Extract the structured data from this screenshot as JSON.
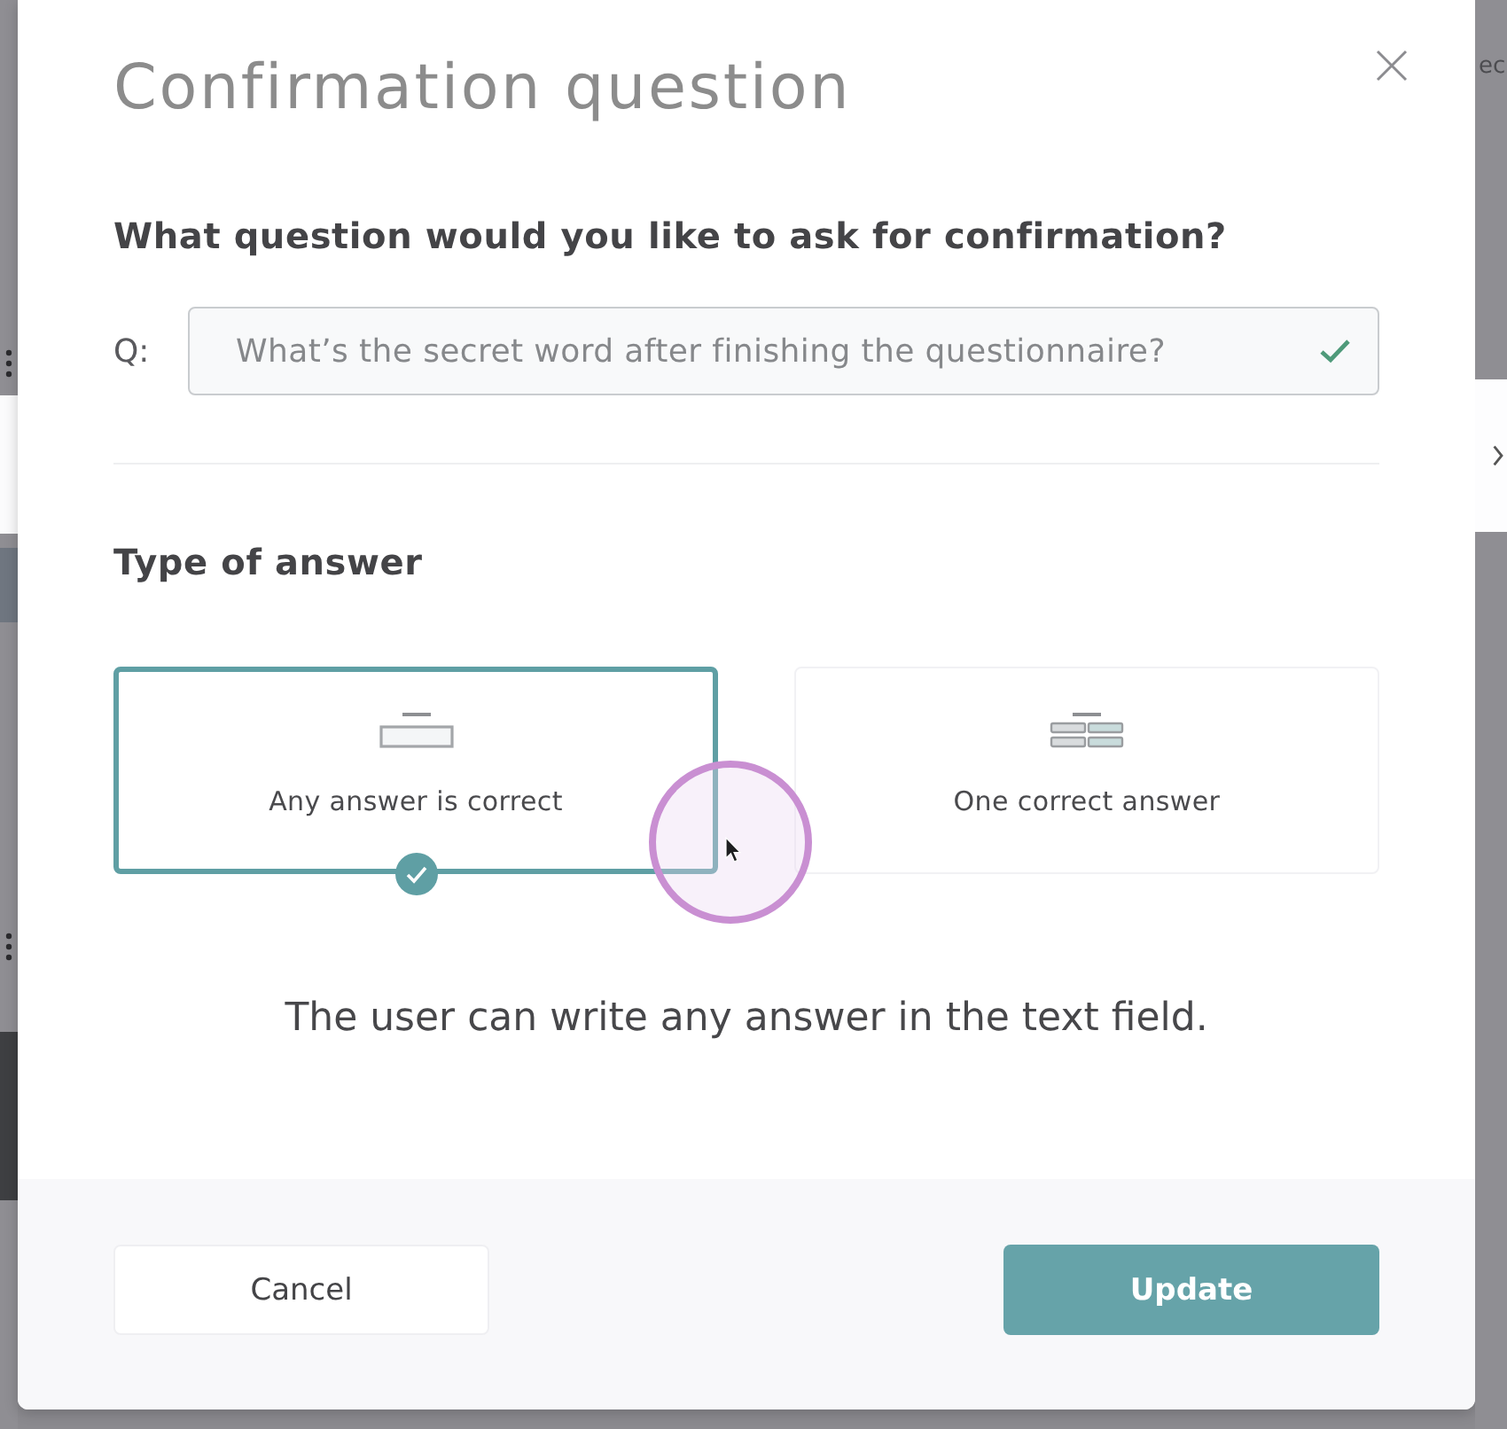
{
  "backdrop": {
    "text_fragment": "ec"
  },
  "dialog": {
    "title": "Confirmation question",
    "question_section": {
      "heading": "What question would you like to ask for confirmation?",
      "prefix": "Q:",
      "field": {
        "value": "What’s the secret word after finishing the questionnaire?",
        "valid": true
      }
    },
    "answer_section": {
      "heading": "Type of answer",
      "options": [
        {
          "kind": "any",
          "label": "Any answer is correct",
          "selected": true
        },
        {
          "kind": "one",
          "label": "One correct answer",
          "selected": false
        }
      ],
      "description": "The user can write any answer in the text field."
    },
    "buttons": [
      {
        "kind": "secondary",
        "label": "Cancel"
      },
      {
        "kind": "primary",
        "label": "Update"
      }
    ]
  }
}
